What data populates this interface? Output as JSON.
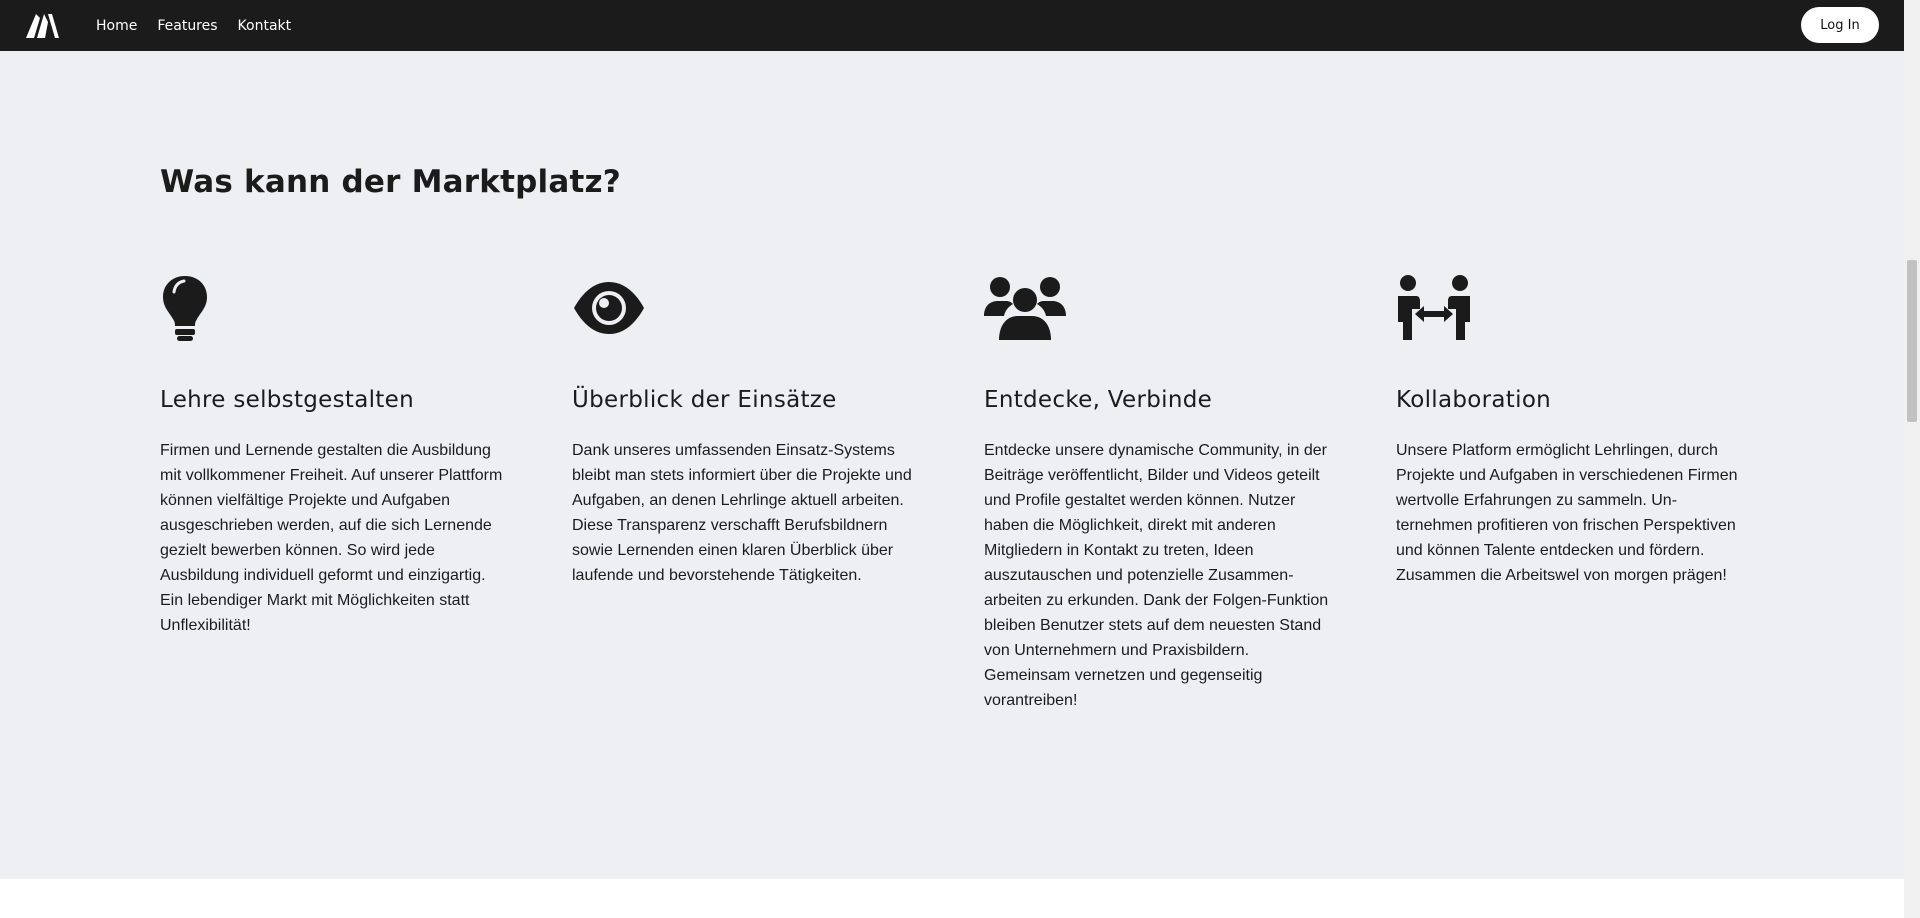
{
  "nav": {
    "logo": "logo-mark",
    "links": [
      "Home",
      "Features",
      "Kontakt"
    ],
    "login_label": "Log In"
  },
  "features": {
    "title": "Was kann der Marktplatz?",
    "items": [
      {
        "icon": "lightbulb-icon",
        "title": "Lehre selbstgestalten",
        "text": "Firmen und Lernende gestalten die Ausbil­dung mit vollkommener Freiheit. Auf unserer Plattform können vielfältige Projekte und Auf­gaben ausgeschrieben werden, auf die sich Lernende gezielt bewerben können. So wird jede Ausbildung individuell geformt und ein­zigartig. Ein lebendiger Markt mit Möglichkei­ten statt Unflexibilität!"
      },
      {
        "icon": "eye-icon",
        "title": "Überblick der Einsätze",
        "text": "Dank unseres umfassenden Einsatz-Systems bleibt man stets informiert über die Projekte und Aufgaben, an denen Lehrlinge aktuell ar­beiten. Diese Transparenz verschafft Berufs­bildnern sowie Lernenden einen klaren Über­blick über laufende und bevorstehende Tätigkeiten."
      },
      {
        "icon": "users-icon",
        "title": "Entdecke, Verbinde",
        "text": "Entdecke unsere dynamische Community, in der Beiträge veröffentlicht, Bilder und Videos geteilt und Profile gestaltet werden können. Nutzer haben die Möglichkeit, direkt mit an­deren Mitgliedern in Kontakt zu treten, Ideen auszutauschen und potenzielle Zusammen­arbeiten zu erkunden. Dank der Folgen-Funk­tion bleiben Benutzer stets auf dem neuesten Stand von Unternehmern und Praxisbildern. Gemeinsam vernetzen und gegenseitig vorantreiben!"
      },
      {
        "icon": "people-arrows-icon",
        "title": "Kollaboration",
        "text": "Unsere Platform ermöglicht Lehrlingen, durch Projekte und Aufgaben in verschiedenen Fir­men wertvolle Erfahrungen zu sammeln. Un­ternehmen profitieren von frischen Perspekti­ven und können Talente entdecken und för­dern. Zusammen die Arbeitswel von morgen prägen!"
      }
    ]
  },
  "colors": {
    "navbar": "#1b1b1b",
    "section_bg": "#eeeff3",
    "text": "#1b1b1b",
    "button_bg": "#ffffff"
  }
}
